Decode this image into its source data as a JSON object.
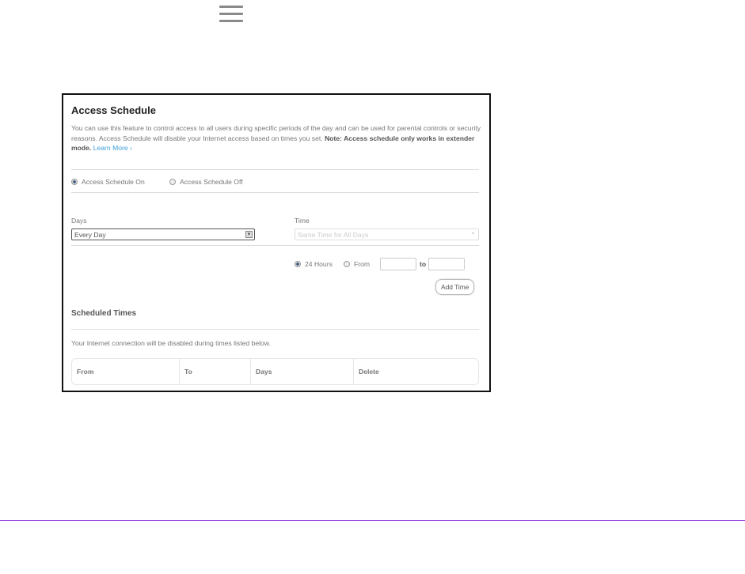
{
  "page": {
    "menu_icon": "hamburger-menu-icon",
    "footer_rule_color": "#8a2be2"
  },
  "screen": {
    "title": "Access Schedule",
    "description": "You can use this feature to control access to all users during specific periods of the day and can be used for parental controls or security reasons. Access Schedule will disable your Internet access based on times you set.",
    "note": "Note: Access schedule only works in extender mode.",
    "learn_more": "Learn More ›",
    "radio_on": "Access Schedule On",
    "radio_off": "Access Schedule Off",
    "schedule_on": true,
    "days_label": "Days",
    "days_value": "Every Day",
    "time_label": "Time",
    "time_value": "Same Time for All Days",
    "hours_24": "24 Hours",
    "from": "From",
    "to": "to",
    "hours_24_selected": true,
    "add_time": "Add Time",
    "scheduled_title": "Scheduled Times",
    "scheduled_desc": "Your Internet connection will be disabled during times listed below.",
    "columns": [
      "From",
      "To",
      "Days",
      "Delete"
    ],
    "link_color": "#3aa0d8"
  }
}
